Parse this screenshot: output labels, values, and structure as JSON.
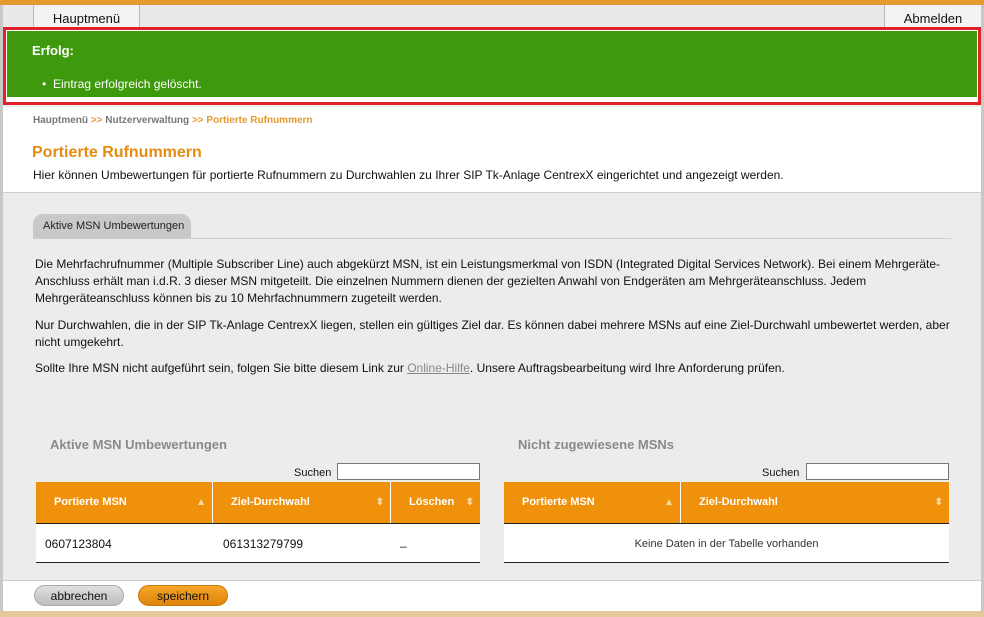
{
  "header": {
    "hauptmenu_label": "Hauptmenü",
    "abmelden_label": "Abmelden"
  },
  "alert": {
    "title": "Erfolg:",
    "message": "Eintrag erfolgreich gelöscht.",
    "color": "#3e9a0c",
    "outline_color": "#e0202a"
  },
  "breadcrumb": {
    "item1": "Hauptmenü",
    "sep": ">>",
    "item2": "Nutzerverwaltung",
    "item3": "Portierte Rufnummern"
  },
  "page": {
    "title": "Portierte Rufnummern",
    "description": "Hier können Umbewertungen für portierte Rufnummern zu Durchwahlen zu Ihrer SIP Tk-Anlage CentrexX eingerichtet und angezeigt werden."
  },
  "tab": {
    "label": "Aktive MSN Umbewertungen"
  },
  "paragraphs": {
    "p1": "Die Mehrfachrufnummer (Multiple Subscriber Line) auch abgekürzt MSN, ist ein Leistungsmerkmal von ISDN (Integrated Digital Services Network). Bei einem Mehrgeräte-Anschluss erhält man i.d.R. 3 dieser MSN mitgeteilt. Die einzelnen Nummern dienen der gezielten Anwahl von Endgeräten am Mehrgeräteanschluss. Jedem Mehrgeräteanschluss können bis zu 10 Mehrfachnummern zugeteilt werden.",
    "p2": "Nur Durchwahlen, die in der SIP Tk-Anlage CentrexX liegen, stellen ein gültiges Ziel dar. Es können dabei mehrere MSNs auf eine Ziel-Durchwahl umbewertet werden, aber nicht umgekehrt.",
    "p3_before": "Sollte Ihre MSN nicht aufgeführt sein, folgen Sie bitte diesem Link zur ",
    "p3_link": "Online-Hilfe",
    "p3_after": ". Unsere Auftragsbearbeitung wird Ihre Anforderung prüfen."
  },
  "left_table": {
    "title": "Aktive MSN Umbewertungen",
    "search_label": "Suchen",
    "search_value": "",
    "columns": [
      "Portierte MSN",
      "Ziel-Durchwahl",
      "Löschen"
    ],
    "rows": [
      {
        "msn": "0607123804",
        "ziel": "061313279799",
        "loeschen": "_"
      }
    ]
  },
  "right_table": {
    "title": "Nicht zugewiesene MSNs",
    "search_label": "Suchen",
    "search_value": "",
    "columns": [
      "Portierte MSN",
      "Ziel-Durchwahl"
    ],
    "empty_message": "Keine Daten in der Tabelle vorhanden"
  },
  "footer": {
    "cancel_label": "abbrechen",
    "save_label": "speichern"
  },
  "colors": {
    "accent": "#f0910c",
    "title": "#e58b10"
  }
}
